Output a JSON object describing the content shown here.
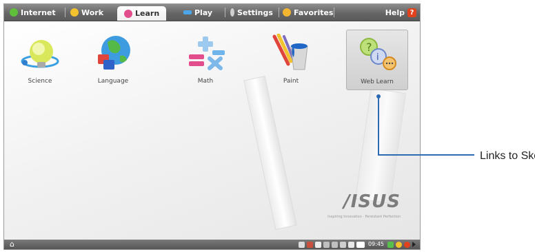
{
  "tabs": [
    {
      "label": "Internet",
      "active": false,
      "color": "#5fbf3a"
    },
    {
      "label": "Work",
      "active": false,
      "color": "#f2c32e"
    },
    {
      "label": "Learn",
      "active": true,
      "color": "#e24e8b"
    },
    {
      "label": "Play",
      "active": false,
      "color": "#4aa6e8"
    },
    {
      "label": "Settings",
      "active": false,
      "color": "#cfcfcf"
    },
    {
      "label": "Favorites",
      "active": false,
      "color": "#f2b630"
    }
  ],
  "help_label": "Help",
  "help_icon_glyph": "?",
  "apps": [
    {
      "label": "Science",
      "icon": "science-icon"
    },
    {
      "label": "Language",
      "icon": "language-icon"
    },
    {
      "label": "Math",
      "icon": "math-icon"
    },
    {
      "label": "Paint",
      "icon": "paint-icon"
    },
    {
      "label": "Web Learn",
      "icon": "web-learn-icon",
      "selected": true
    }
  ],
  "brand_logo": "/ISUS",
  "brand_sub": "Inspiring Innovation · Persistent Perfection",
  "taskbar": {
    "home_glyph": "⌂",
    "clock": "09:45"
  },
  "annotation": "Links to Skoool",
  "colors": {
    "accent": "#2c6bb3",
    "help_red": "#e2411d"
  }
}
